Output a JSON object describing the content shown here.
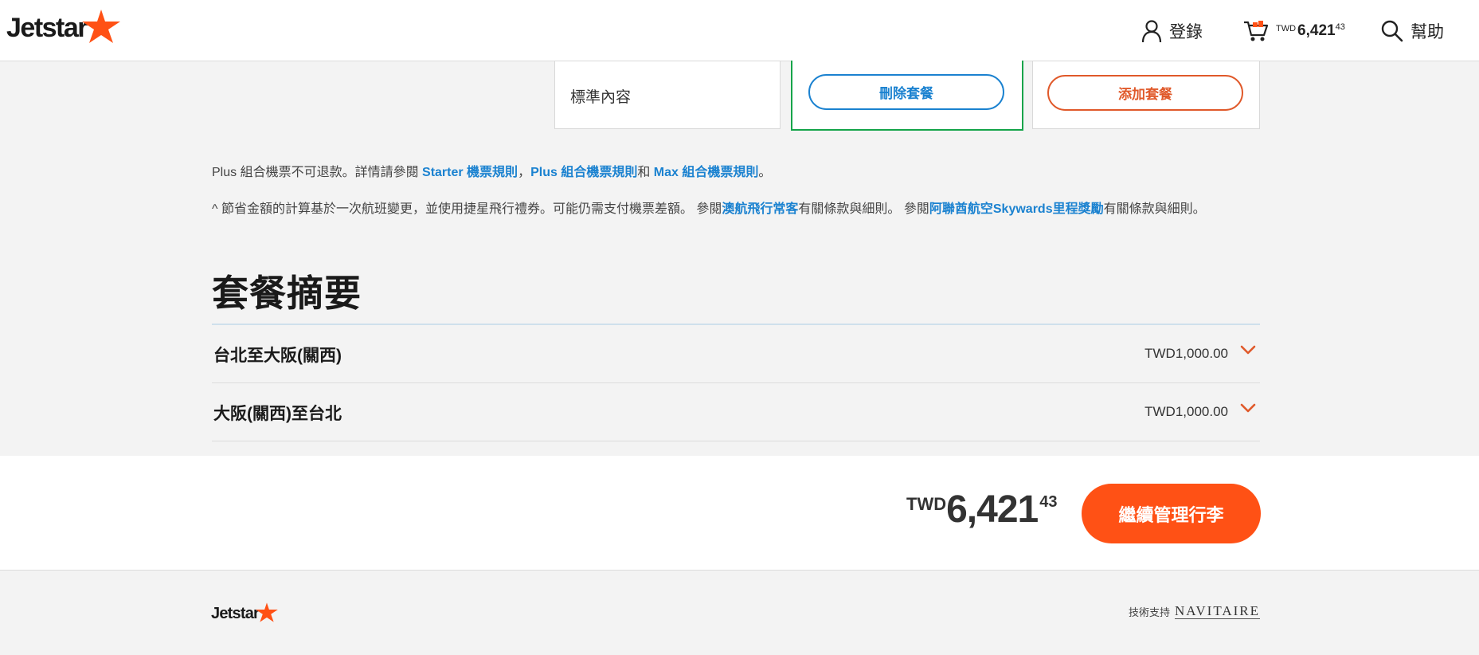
{
  "header": {
    "logo_text": "Jetstar",
    "login_label": "登錄",
    "cart": {
      "currency": "TWD",
      "amount": "6,421",
      "decimals": "43"
    },
    "help_label": "幫助"
  },
  "fare_cards": {
    "standard_label": "標準內容",
    "remove_label": "刪除套餐",
    "add_label": "添加套餐"
  },
  "notes": {
    "line1": {
      "prefix": "Plus 組合機票不可退款。詳情請參閱 ",
      "link1": "Starter 機票規則",
      "sep1": "，",
      "link2": "Plus 組合機票規則",
      "sep2": "和 ",
      "link3": "Max 組合機票規則",
      "suffix": "。"
    },
    "line2": {
      "prefix": "^ 節省金額的計算基於一次航班變更，並使用捷星飛行禮券。可能仍需支付機票差額。 參閱",
      "link1": "澳航飛行常客",
      "mid": "有關條款與細則。 參閱",
      "link2": "阿聯酋航空Skywards里程獎勵",
      "suffix": "有關條款與細則。"
    }
  },
  "summary": {
    "title": "套餐摘要",
    "rows": [
      {
        "label": "台北至大阪(關西)",
        "price": "TWD1,000.00"
      },
      {
        "label": "大阪(關西)至台北",
        "price": "TWD1,000.00"
      }
    ]
  },
  "total": {
    "currency": "TWD",
    "amount": "6,421",
    "decimals": "43"
  },
  "continue_label": "繼續管理行李",
  "footer": {
    "logo_text": "Jetstar",
    "powered_by": "技術支持",
    "provider": "NAVITAIRE"
  },
  "colors": {
    "accent_orange": "#ff5115",
    "link_blue": "#1b82d0",
    "selected_green": "#14a44a"
  },
  "icons": [
    "jetstar-star-icon",
    "user-icon",
    "cart-icon",
    "search-icon",
    "chevron-down-icon"
  ]
}
